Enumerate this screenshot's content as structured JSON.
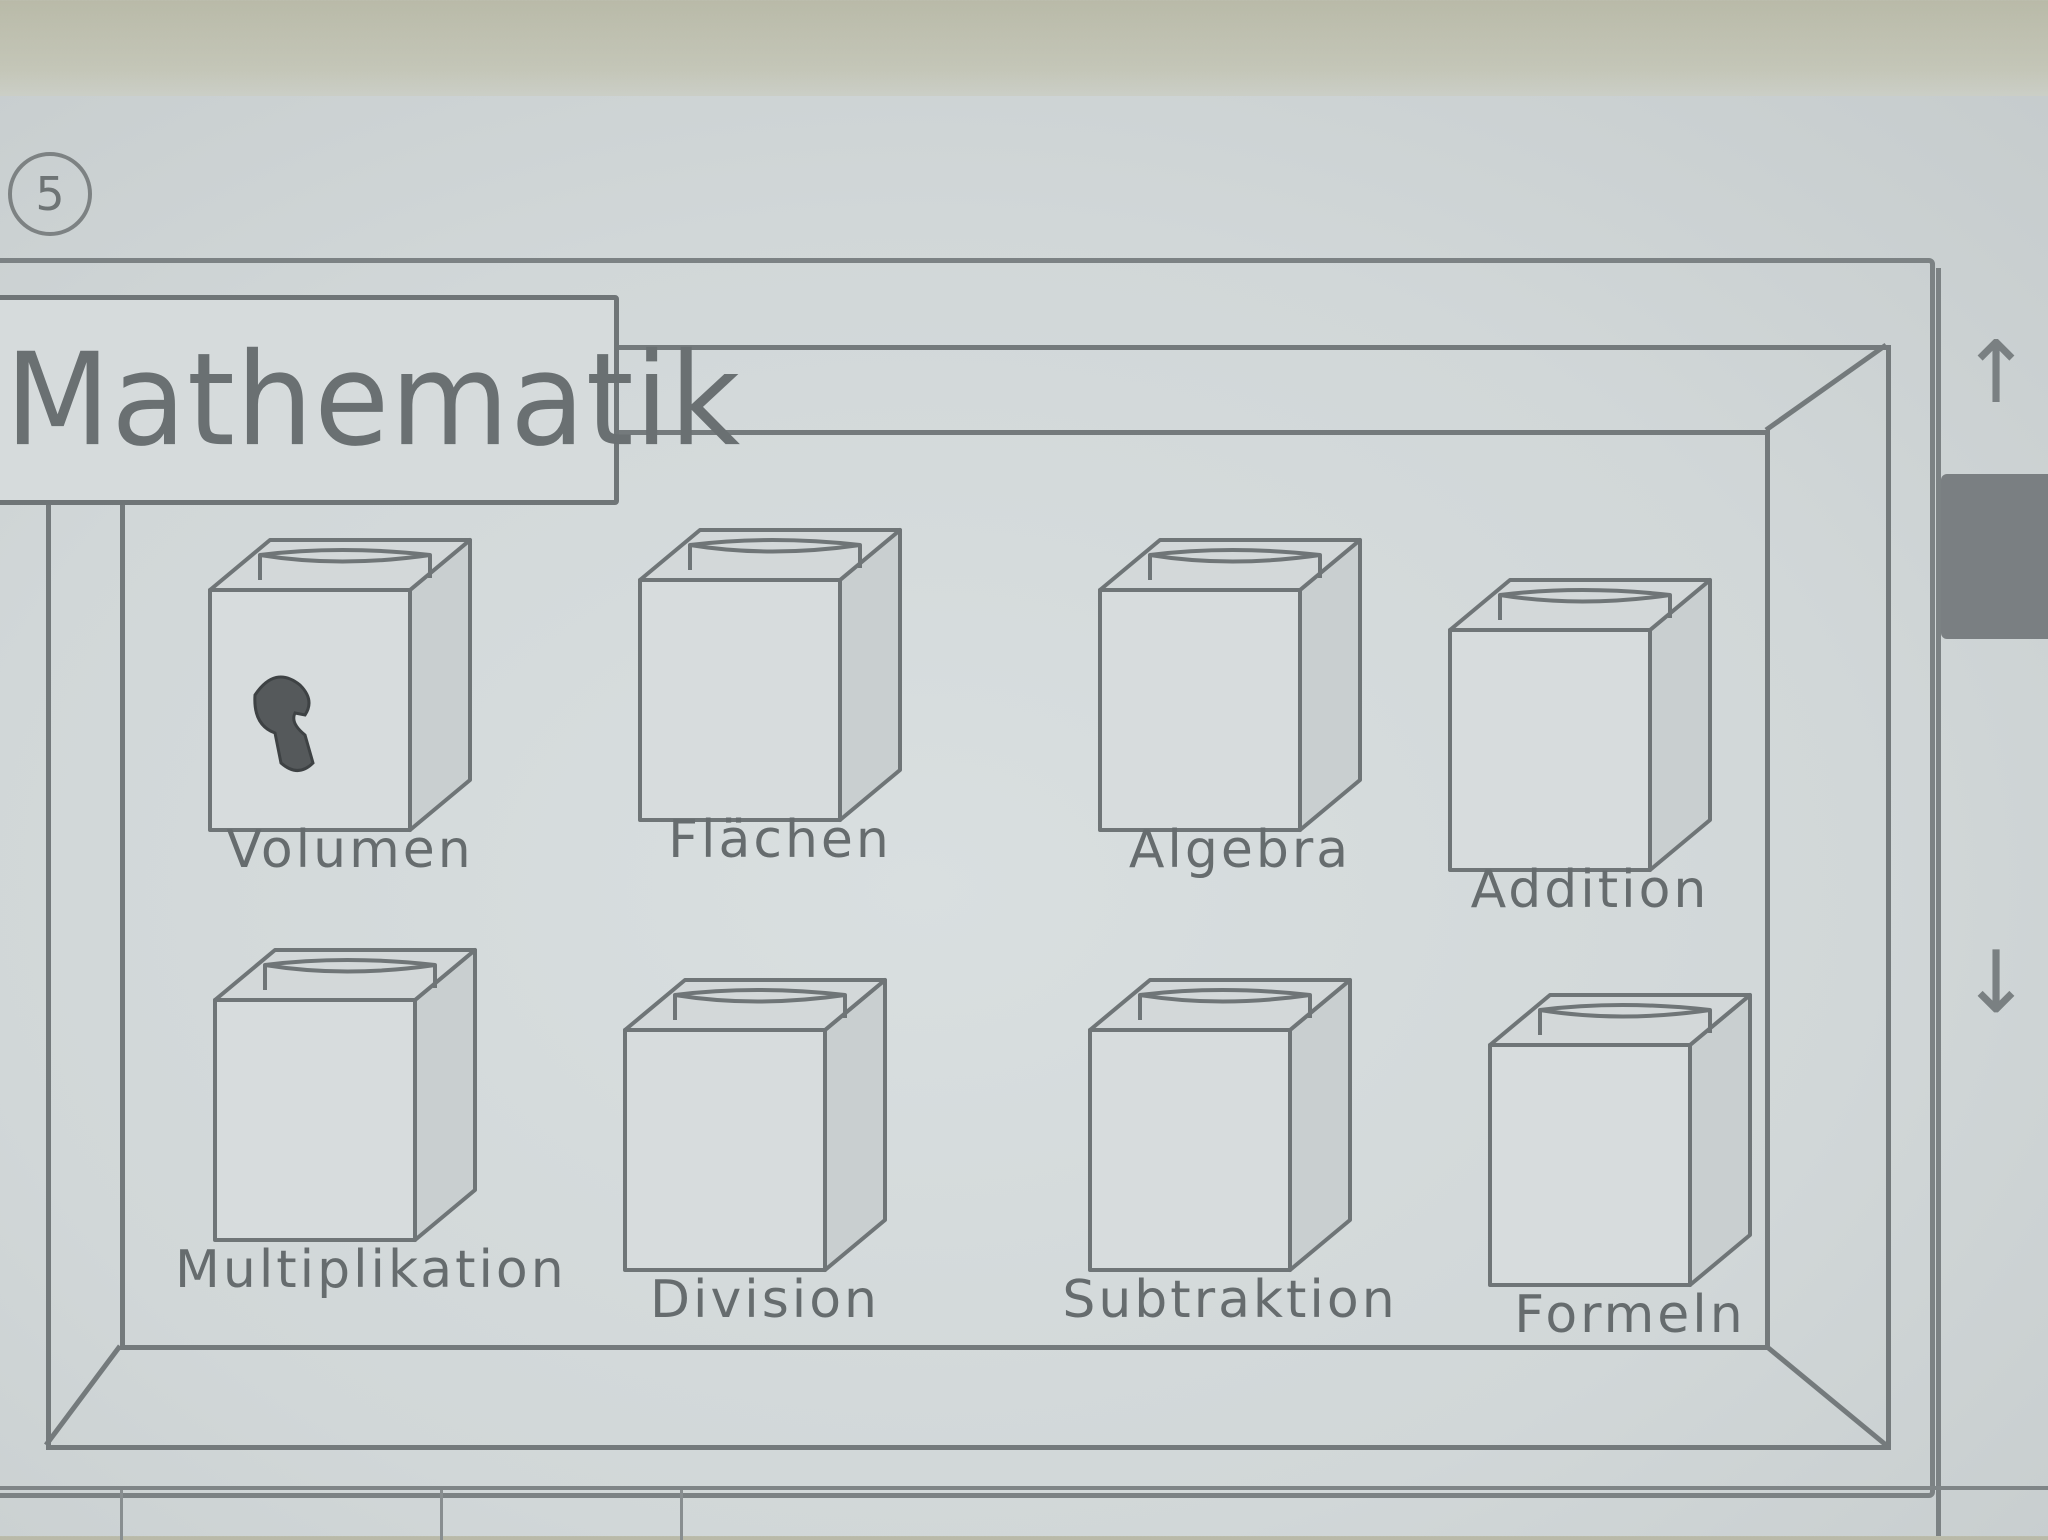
{
  "page": {
    "step_number": "5",
    "title": "Mathematik"
  },
  "tiles": [
    {
      "id": "volumen",
      "label": "Volumen",
      "icon": "cursor-hand-icon"
    },
    {
      "id": "flachen",
      "label": "Flächen"
    },
    {
      "id": "algebra",
      "label": "Algebra"
    },
    {
      "id": "addition",
      "label": "Addition"
    },
    {
      "id": "multiplikation",
      "label": "Multiplikation"
    },
    {
      "id": "division",
      "label": "Division"
    },
    {
      "id": "subtraktion",
      "label": "Subtraktion"
    },
    {
      "id": "formeln",
      "label": "Formeln"
    }
  ],
  "scrollbar": {
    "up_icon": "arrow-up-icon",
    "down_icon": "arrow-down-icon"
  },
  "colors": {
    "paper": "#d3d9da",
    "pencil": "#6f7577",
    "thumb": "#7a7f82"
  }
}
